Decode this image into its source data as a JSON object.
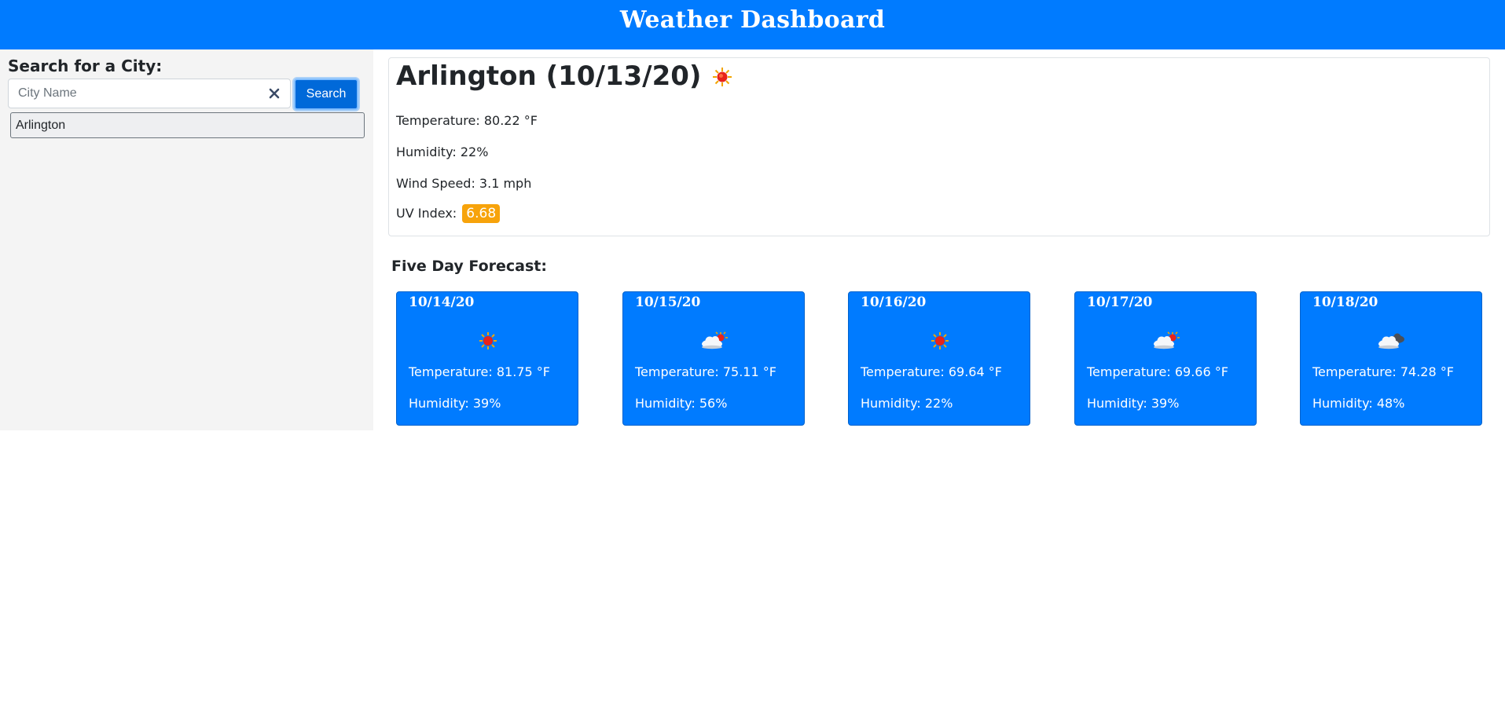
{
  "header": {
    "title": "Weather Dashboard"
  },
  "sidebar": {
    "title": "Search for a City:",
    "search": {
      "placeholder": "City Name",
      "value": ""
    },
    "search_button_label": "Search",
    "history": [
      {
        "label": "Arlington"
      }
    ]
  },
  "current": {
    "title": "Arlington (10/13/20)",
    "icon": "sun-icon",
    "temperature": "Temperature: 80.22 °F",
    "humidity": "Humidity: 22%",
    "wind": "Wind Speed: 3.1 mph",
    "uv_label": "UV Index:",
    "uv_value": "6.68",
    "uv_color": "#f7a30b"
  },
  "forecast": {
    "title": "Five Day Forecast:",
    "days": [
      {
        "date": "10/14/20",
        "icon": "sun-icon",
        "temperature": "Temperature: 81.75 °F",
        "humidity": "Humidity: 39%"
      },
      {
        "date": "10/15/20",
        "icon": "partly-cloudy-icon",
        "temperature": "Temperature: 75.11 °F",
        "humidity": "Humidity: 56%"
      },
      {
        "date": "10/16/20",
        "icon": "sun-icon",
        "temperature": "Temperature: 69.64 °F",
        "humidity": "Humidity: 22%"
      },
      {
        "date": "10/17/20",
        "icon": "partly-cloudy-icon",
        "temperature": "Temperature: 69.66 °F",
        "humidity": "Humidity: 39%"
      },
      {
        "date": "10/18/20",
        "icon": "dark-cloud-icon",
        "temperature": "Temperature: 74.28 °F",
        "humidity": "Humidity: 48%"
      }
    ]
  },
  "colors": {
    "accent": "#007bff",
    "sidebar_bg": "#f4f4f4",
    "uv_moderate": "#f7a30b"
  }
}
